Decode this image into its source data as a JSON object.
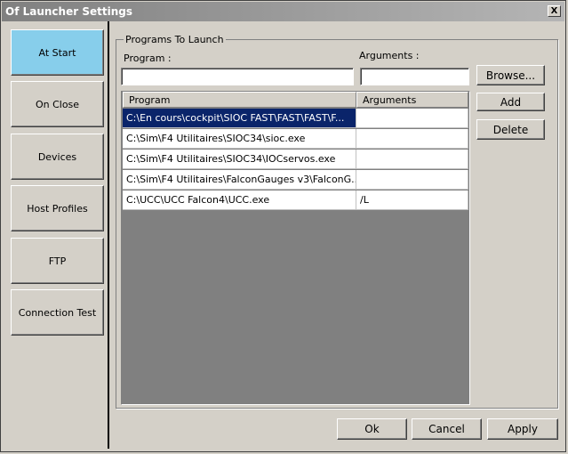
{
  "window": {
    "title": "Of Launcher Settings",
    "close_glyph": "X"
  },
  "sidebar": {
    "items": [
      {
        "label": "At Start",
        "active": true
      },
      {
        "label": "On Close",
        "active": false
      },
      {
        "label": "Devices",
        "active": false
      },
      {
        "label": "Host Profiles",
        "active": false
      },
      {
        "label": "FTP",
        "active": false
      },
      {
        "label": "Connection Test",
        "active": false
      }
    ]
  },
  "programs": {
    "group_title": "Programs To Launch",
    "program_label": "Program :",
    "arguments_label": "Arguments :",
    "program_value": "",
    "arguments_value": "",
    "browse_label": "Browse...",
    "add_label": "Add",
    "delete_label": "Delete",
    "columns": [
      "Program",
      "Arguments"
    ],
    "rows": [
      {
        "program": "C:\\En cours\\cockpit\\SIOC FAST\\FAST\\FAST\\F...",
        "arguments": "",
        "selected": true
      },
      {
        "program": "C:\\Sim\\F4 Utilitaires\\SIOC34\\sioc.exe",
        "arguments": ""
      },
      {
        "program": "C:\\Sim\\F4 Utilitaires\\SIOC34\\IOCservos.exe",
        "arguments": ""
      },
      {
        "program": "C:\\Sim\\F4 Utilitaires\\FalconGauges v3\\FalconG...",
        "arguments": ""
      },
      {
        "program": "C:\\UCC\\UCC Falcon4\\UCC.exe",
        "arguments": "/L"
      }
    ]
  },
  "footer": {
    "ok_label": "Ok",
    "cancel_label": "Cancel",
    "apply_label": "Apply"
  },
  "colors": {
    "active_tab": "#87ceeb",
    "selection": "#0a246a",
    "face": "#d4d0c8"
  }
}
